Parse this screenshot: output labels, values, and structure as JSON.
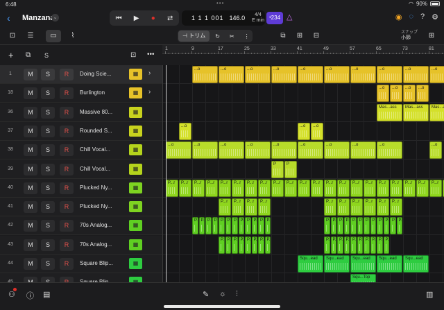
{
  "status": {
    "time": "6:48",
    "battery": "90%",
    "dots": "•••"
  },
  "project": {
    "name": "Manzana",
    "back_icon": "chevron-left-icon"
  },
  "transport": {
    "rewind": "⏮",
    "play": "▶",
    "record": "●",
    "cycle": "⇄"
  },
  "lcd": {
    "position": "1 1 1 001",
    "tempo": "146.0",
    "time_sig": "4/4",
    "key": "E min"
  },
  "count_in": "¹234",
  "toolbar": {
    "trim_label": "トリム",
    "snap_label": "スナップ",
    "snap_value": "小節"
  },
  "header": {
    "add": "+",
    "s_label": "S"
  },
  "ruler": {
    "bars": [
      "1",
      "9",
      "17",
      "25",
      "33",
      "41",
      "49",
      "57",
      "65",
      "73",
      "81"
    ]
  },
  "tracks": [
    {
      "num": "1",
      "m": "M",
      "s": "S",
      "r": "R",
      "name": "Doing Scie...",
      "icon_color": "#e6c229",
      "icon": "drum-machine-icon",
      "chev": "›",
      "selected": true
    },
    {
      "num": "18",
      "m": "M",
      "s": "S",
      "r": "R",
      "name": "Burlington",
      "icon_color": "#e6c229",
      "icon": "drum-machine-icon",
      "chev": "›"
    },
    {
      "num": "36",
      "m": "M",
      "s": "S",
      "r": "R",
      "name": "Massive 80...",
      "icon_color": "#c8d21e",
      "icon": "keyboard-icon"
    },
    {
      "num": "37",
      "m": "M",
      "s": "S",
      "r": "R",
      "name": "Rounded S...",
      "icon_color": "#c8d21e",
      "icon": "keyboard-icon"
    },
    {
      "num": "38",
      "m": "M",
      "s": "S",
      "r": "R",
      "name": "Chill Vocal...",
      "icon_color": "#b5d41c",
      "icon": "keyboard-icon"
    },
    {
      "num": "39",
      "m": "M",
      "s": "S",
      "r": "R",
      "name": "Chill Vocal...",
      "icon_color": "#b5d41c",
      "icon": "keyboard-icon"
    },
    {
      "num": "40",
      "m": "M",
      "s": "S",
      "r": "R",
      "name": "Plucked Ny...",
      "icon_color": "#7ed321",
      "icon": "synth-icon"
    },
    {
      "num": "41",
      "m": "M",
      "s": "S",
      "r": "R",
      "name": "Plucked Ny...",
      "icon_color": "#7ed321",
      "icon": "synth-icon"
    },
    {
      "num": "42",
      "m": "M",
      "s": "S",
      "r": "R",
      "name": "70s Analog...",
      "icon_color": "#5fcf22",
      "icon": "synth-icon"
    },
    {
      "num": "43",
      "m": "M",
      "s": "S",
      "r": "R",
      "name": "70s Analog...",
      "icon_color": "#5fcf22",
      "icon": "synth-icon"
    },
    {
      "num": "44",
      "m": "M",
      "s": "S",
      "r": "R",
      "name": "Square Blip...",
      "icon_color": "#2ecc40",
      "icon": "keyboard-icon"
    },
    {
      "num": "45",
      "m": "M",
      "s": "S",
      "r": "R",
      "name": "Square Blip...",
      "icon_color": "#2ecc40",
      "icon": "keyboard-icon"
    }
  ],
  "region_labels": {
    "doing": "...o",
    "mass": "Mas...ass",
    "p": "P",
    "pr": "P...r",
    "squ": "Squ...ead",
    "top": "Squ...Top",
    "dots": "...o"
  }
}
